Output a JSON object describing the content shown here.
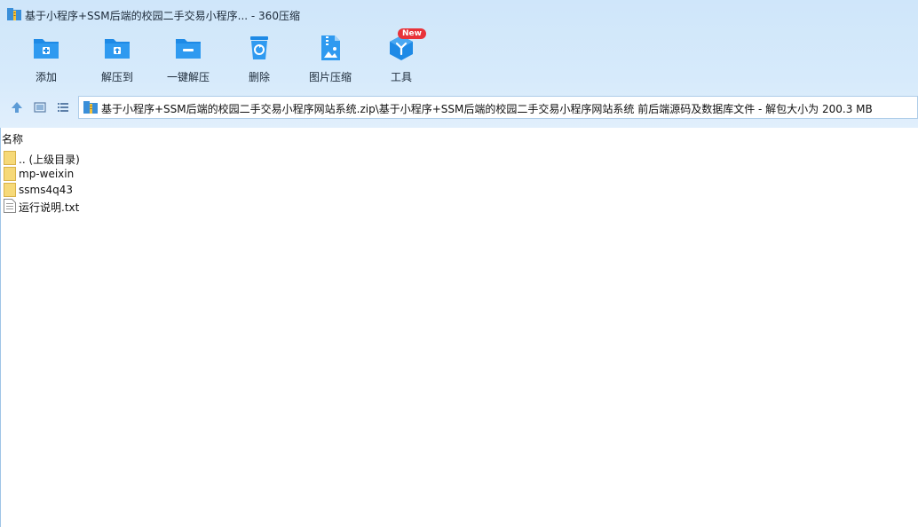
{
  "window": {
    "title": "基于小程序+SSM后端的校园二手交易小程序... - 360压缩"
  },
  "toolbar": {
    "buttons": [
      {
        "label": "添加",
        "icon": "add-folder-icon"
      },
      {
        "label": "解压到",
        "icon": "extract-to-icon"
      },
      {
        "label": "一键解压",
        "icon": "one-click-extract-icon"
      },
      {
        "label": "删除",
        "icon": "recycle-bin-icon"
      },
      {
        "label": "图片压缩",
        "icon": "image-compress-icon"
      },
      {
        "label": "工具",
        "icon": "tools-cube-icon",
        "badge": "New"
      }
    ]
  },
  "address": {
    "path": "基于小程序+SSM后端的校园二手交易小程序网站系统.zip\\基于小程序+SSM后端的校园二手交易小程序网站系统 前后端源码及数据库文件 - 解包大小为 200.3 MB"
  },
  "list": {
    "column_name": "名称",
    "items": [
      {
        "name": ".. (上级目录)",
        "type": "folder"
      },
      {
        "name": "mp-weixin",
        "type": "folder"
      },
      {
        "name": "ssms4q43",
        "type": "folder"
      },
      {
        "name": "运行说明.txt",
        "type": "text-file"
      }
    ]
  },
  "colors": {
    "accent": "#1e8ae6",
    "badge": "#e8333a",
    "folder": "#f6d978"
  }
}
